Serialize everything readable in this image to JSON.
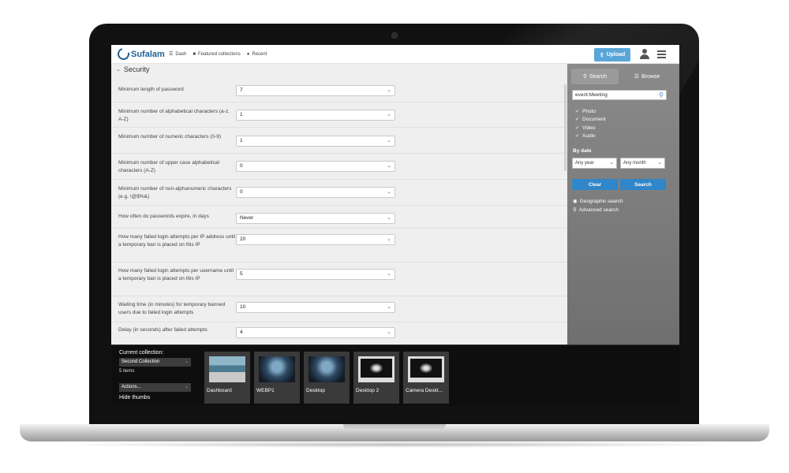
{
  "header": {
    "logo_text": "Sufalam",
    "nav": [
      {
        "icon": "dash-icon",
        "label": "Dash"
      },
      {
        "icon": "folder-icon",
        "label": "Featured collections"
      },
      {
        "icon": "clock-icon",
        "label": "Recent"
      }
    ],
    "upload_label": "Upload"
  },
  "main": {
    "section_title": "Security",
    "rows": [
      {
        "label": "Minimum length of password",
        "value": "7"
      },
      {
        "label": "Minimum number of alphabetical characters (a-z, A-Z)",
        "value": "1"
      },
      {
        "label": "Minimum number of numeric characters (0-9)",
        "value": "1"
      },
      {
        "label": "Minimum number of upper case alphabetical characters (A-Z)",
        "value": "0"
      },
      {
        "label": "Minimum number of non-alphanumeric characters (e.g. !@$%&)",
        "value": "0"
      },
      {
        "label": "How often do passwords expire, in days",
        "value": "Never"
      },
      {
        "label": "How many failed login attempts per IP address until a temporary ban is placed on this IP",
        "value": "20"
      },
      {
        "label": "How many failed login attempts per username until a temporary ban is placed on this IP",
        "value": "5"
      },
      {
        "label": "Waiting time (in minutes) for temporary banned users due to failed login attempts",
        "value": "10"
      },
      {
        "label": "Delay (in seconds) after failed attempts",
        "value": "4"
      }
    ]
  },
  "side": {
    "tab_search": "Search",
    "tab_browse": "Browse",
    "search_value": "event:Meeting",
    "types": [
      "Photo",
      "Document",
      "Video",
      "Audio"
    ],
    "bydate_label": "By date",
    "year_value": "Any year",
    "month_value": "Any month",
    "clear_label": "Clear",
    "search_label": "Search",
    "geo_label": "Geographic search",
    "advanced_label": "Advanced search"
  },
  "collection": {
    "current_label": "Current collection:",
    "selected": "Second Collection",
    "count": "5 items",
    "actions": "Actions...",
    "hide_thumbs": "Hide thumbs",
    "thumbs": [
      {
        "label": "Dashboard",
        "kind": "dash"
      },
      {
        "label": "WEBP1",
        "kind": "desk"
      },
      {
        "label": "Desktop",
        "kind": "desk"
      },
      {
        "label": "Desktop 2",
        "kind": "monitor"
      },
      {
        "label": "Camera Deskt...",
        "kind": "monitor"
      }
    ]
  },
  "colors": {
    "accent": "#2f86c9",
    "upload": "#59a6d9",
    "brand": "#1e5f95"
  }
}
